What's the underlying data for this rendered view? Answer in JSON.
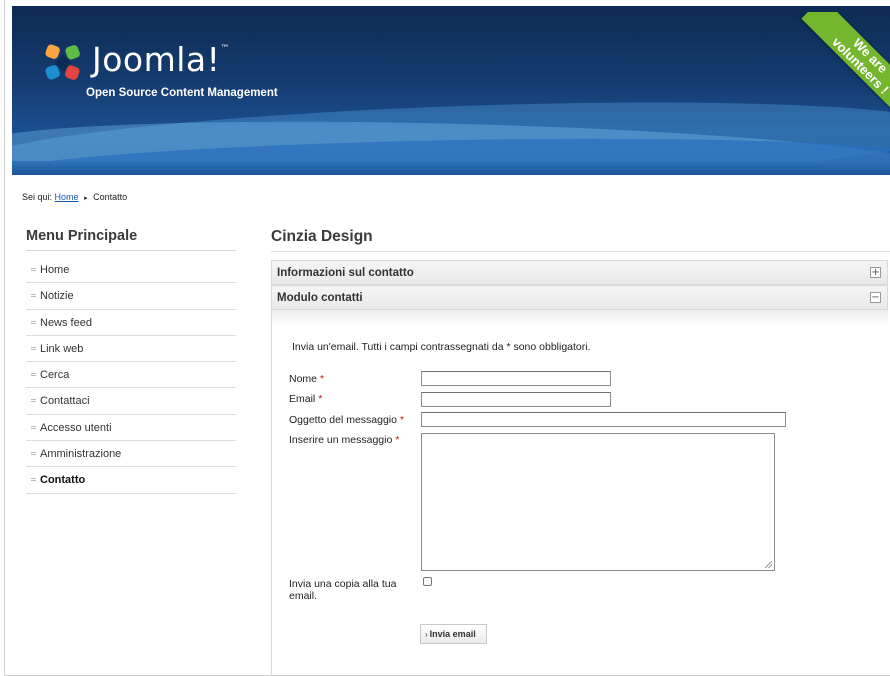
{
  "header": {
    "logo_text": "Joomla!",
    "logo_tm": "™",
    "subtitle": "Open Source Content Management",
    "ribbon_line1": "We are",
    "ribbon_line2": "volunteers !"
  },
  "breadcrumb": {
    "prefix": "Sei qui:",
    "home": "Home",
    "separator": "▸",
    "current": "Contatto"
  },
  "sidebar": {
    "title": "Menu Principale",
    "items": [
      {
        "label": "Home"
      },
      {
        "label": "Notizie"
      },
      {
        "label": "News feed"
      },
      {
        "label": "Link web"
      },
      {
        "label": "Cerca"
      },
      {
        "label": "Contattaci"
      },
      {
        "label": "Accesso utenti"
      },
      {
        "label": "Amministrazione"
      },
      {
        "label": "Contatto",
        "active": true
      }
    ]
  },
  "main": {
    "title": "Cinzia Design",
    "accordion": [
      {
        "label": "Informazioni sul contatto",
        "toggle": "+"
      },
      {
        "label": "Modulo contatti",
        "toggle": "−"
      }
    ],
    "form": {
      "intro": "Invia un'email. Tutti i campi contrassegnati da * sono obbligatori.",
      "required_mark": "*",
      "name_label": "Nome",
      "email_label": "Email",
      "subject_label": "Oggetto del messaggio",
      "message_label": "Inserire un messaggio",
      "copy_label": "Invia una copia alla tua email.",
      "name_value": "",
      "email_value": "",
      "subject_value": "",
      "message_value": "",
      "copy_checked": false,
      "submit_label": "Invia email",
      "submit_arrow": "›"
    }
  },
  "colors": {
    "header_dark": "#0d2a52",
    "ribbon": "#74b72f",
    "link": "#1b57b1",
    "required": "#c4161c"
  }
}
